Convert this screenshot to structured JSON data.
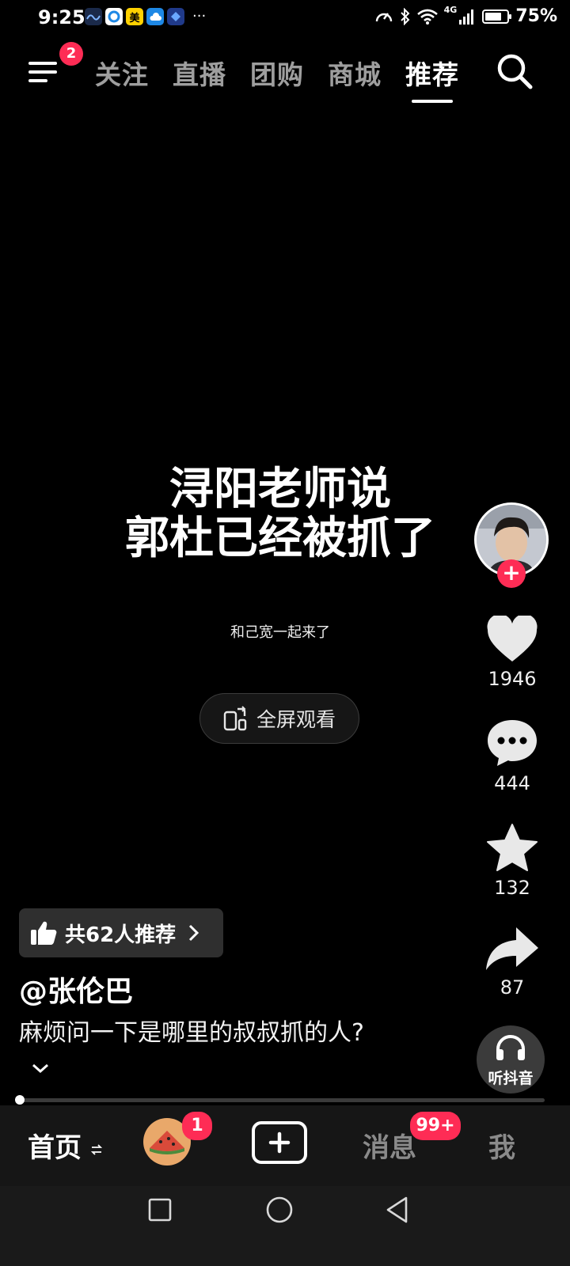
{
  "status_bar": {
    "time": "9:25",
    "notification_icons": [
      "wave-app-icon",
      "browser-icon",
      "meituan-icon",
      "weather-icon",
      "game-icon"
    ],
    "notification_label_meituan": "美",
    "more": "···",
    "network": "4G",
    "battery": "75%",
    "battery_level": 0.75
  },
  "top_nav": {
    "menu_badge": "2",
    "tabs": [
      {
        "label": "关注",
        "active": false
      },
      {
        "label": "直播",
        "active": false
      },
      {
        "label": "团购",
        "active": false
      },
      {
        "label": "商城",
        "active": false
      },
      {
        "label": "推荐",
        "active": true
      }
    ]
  },
  "video": {
    "headline_line1": "浔阳老师说",
    "headline_line2": "郭杜已经被抓了",
    "subtitle": "和己宽一起来了",
    "fullscreen_label": "全屏观看",
    "progress": 0.0
  },
  "right_rail": {
    "likes": "1946",
    "comments": "444",
    "favorites": "132",
    "shares": "87",
    "listen_label": "听抖音"
  },
  "info": {
    "recommend_text": "共62人推荐",
    "author": "@张伦巴",
    "caption": "麻烦问一下是哪里的叔叔抓的人?"
  },
  "bottom_tabs": {
    "home": "首页",
    "friends_badge": "1",
    "messages": "消息",
    "messages_badge": "99+",
    "me": "我"
  },
  "colors": {
    "accent": "#fe2c55",
    "background": "#000000",
    "bottom_bar": "#161616"
  }
}
